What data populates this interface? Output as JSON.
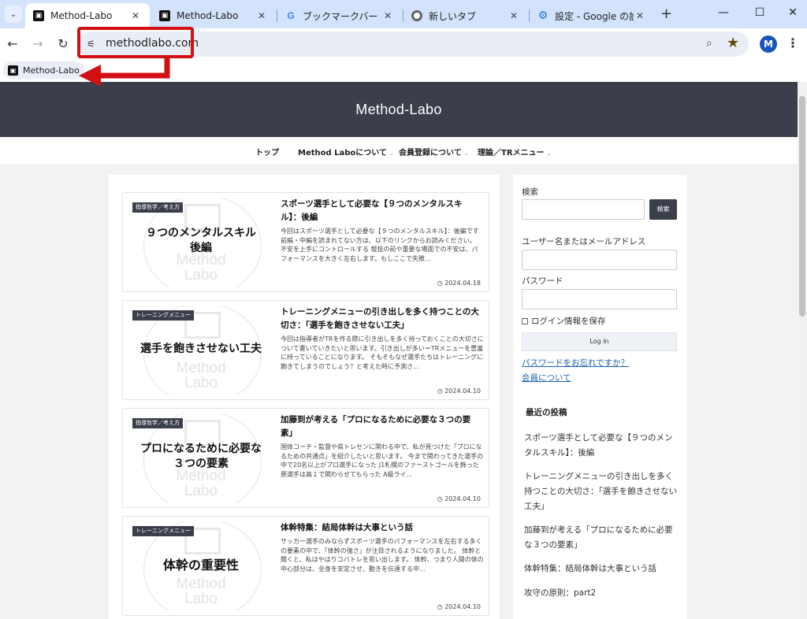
{
  "browser": {
    "tabs": [
      {
        "label": "Method-Labo",
        "favicon": "method-labo-favicon",
        "active": true
      },
      {
        "label": "Method-Labo",
        "favicon": "method-labo-favicon",
        "active": false
      },
      {
        "label": "ブックマークバー　表示",
        "favicon": "google-g-icon",
        "active": false
      },
      {
        "label": "新しいタブ",
        "favicon": "chrome-icon",
        "active": false
      },
      {
        "label": "設定 - Google の設定",
        "favicon": "settings-gear-icon",
        "active": false
      }
    ],
    "close_glyph": "✕",
    "new_tab_glyph": "+",
    "url": "methodlabo.com",
    "profile_initial": "M",
    "bookmark": {
      "label": "Method-Labo"
    },
    "accent_color": "#d40f14"
  },
  "site": {
    "title": "Method-Labo",
    "header_color": "#3b3f4c",
    "nav": [
      {
        "label": "トップ",
        "has_submenu": false
      },
      {
        "label": "Method Laboについて",
        "has_submenu": true
      },
      {
        "label": "会員登録について",
        "has_submenu": true
      },
      {
        "label": "理論／TRメニュー",
        "has_submenu": true
      }
    ],
    "watermark": {
      "line1": "Method",
      "line2": "Labo"
    },
    "posts": [
      {
        "category": "指導哲学／考え方",
        "thumb_title": "９つのメンタルスキル\n後編",
        "title": "スポーツ選手として必要な【９つのメンタルスキル】：後編",
        "excerpt": "今回はスポーツ選手として必要な【９つのメンタルスキル】：後編です 前編・中編を読まれてない方は、以下のリンクからお読みください。 不安を上手にコントロールする 競技の前や重要な場面での不安は、パフォーマンスを大きく左右します。もしここで失敗...",
        "date": "2024.04.18"
      },
      {
        "category": "トレーニングメニュー",
        "thumb_title": "選手を飽きさせない工夫",
        "title": "トレーニングメニューの引き出しを多く持つことの大切さ：「選手を飽きさせない工夫」",
        "excerpt": "今回は指導者がTRを作る際に引き出しを多く持っておくことの大切さについて書いていきたいと思います。引き出しが多い＝TRメニューを豊富に持っていることになります。 そもそもなぜ選手たちはトレーニングに飽きてしまうのでしょう？と考えた時に予測さ...",
        "date": "2024.04.10"
      },
      {
        "category": "指導哲学／考え方",
        "thumb_title": "プロになるために必要な\n３つの要素",
        "title": "加藤到が考える「プロになるために必要な３つの要素」",
        "excerpt": "国体コーチ・監督や県トレセンに関わる中で、私が見つけた「プロになるための共通点」を紹介したいと思います。 今まで関わってきた選手の中で20名以上がプロ選手になった J1札幌のファーストゴールを飾った原選手は高１で関わらせてもらった A級ライ...",
        "date": "2024.04.10"
      },
      {
        "category": "トレーニングメニュー",
        "thumb_title": "体幹の重要性",
        "title": "体幹特集：結局体幹は大事という話",
        "excerpt": "サッカー選手のみならずスポーツ選手のパフォーマンスを左右する多くの要素の中で、「体幹の強さ」が注目されるようになりました。 体幹と聞くと、私はやはりコバトレを思い出します。 体幹、つまり人間の体の中心部分は、全身を安定させ、動きを伝達する中...",
        "date": "2024.04.10"
      }
    ],
    "sidebar": {
      "search_label": "検索",
      "search_button": "検索",
      "username_label": "ユーザー名またはメールアドレス",
      "password_label": "パスワード",
      "remember_label": "ログイン情報を保存",
      "login_button": "Log In",
      "forgot_link": "パスワードをお忘れですか？",
      "member_link": "会員について",
      "recent_heading": "最近の投稿",
      "recent_posts": [
        "スポーツ選手として必要な【９つのメンタルスキル】：後編",
        "トレーニングメニューの引き出しを多く持つことの大切さ：「選手を飽きさせない工夫」",
        "加藤到が考える「プロになるために必要な３つの要素」",
        "体幹特集：結局体幹は大事という話",
        "攻守の原則：part2"
      ]
    }
  }
}
